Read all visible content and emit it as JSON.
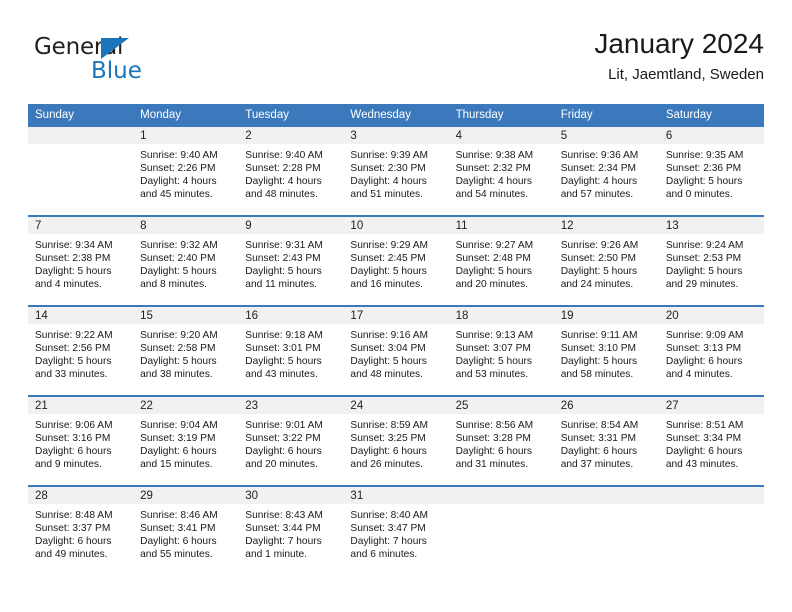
{
  "brand": {
    "name_top": "General",
    "name_bottom": "Blue",
    "accent_color": "#1b75bb"
  },
  "header": {
    "title": "January 2024",
    "subtitle": "Lit, Jaemtland, Sweden"
  },
  "theme": {
    "header_bg": "#3b79bc",
    "daynum_bg": "#f1f1f1",
    "text": "#1a1a1a"
  },
  "weekdays": [
    "Sunday",
    "Monday",
    "Tuesday",
    "Wednesday",
    "Thursday",
    "Friday",
    "Saturday"
  ],
  "weeks": [
    [
      {
        "day": "",
        "sunrise": "",
        "sunset": "",
        "daylight1": "",
        "daylight2": ""
      },
      {
        "day": "1",
        "sunrise": "Sunrise: 9:40 AM",
        "sunset": "Sunset: 2:26 PM",
        "daylight1": "Daylight: 4 hours",
        "daylight2": "and 45 minutes."
      },
      {
        "day": "2",
        "sunrise": "Sunrise: 9:40 AM",
        "sunset": "Sunset: 2:28 PM",
        "daylight1": "Daylight: 4 hours",
        "daylight2": "and 48 minutes."
      },
      {
        "day": "3",
        "sunrise": "Sunrise: 9:39 AM",
        "sunset": "Sunset: 2:30 PM",
        "daylight1": "Daylight: 4 hours",
        "daylight2": "and 51 minutes."
      },
      {
        "day": "4",
        "sunrise": "Sunrise: 9:38 AM",
        "sunset": "Sunset: 2:32 PM",
        "daylight1": "Daylight: 4 hours",
        "daylight2": "and 54 minutes."
      },
      {
        "day": "5",
        "sunrise": "Sunrise: 9:36 AM",
        "sunset": "Sunset: 2:34 PM",
        "daylight1": "Daylight: 4 hours",
        "daylight2": "and 57 minutes."
      },
      {
        "day": "6",
        "sunrise": "Sunrise: 9:35 AM",
        "sunset": "Sunset: 2:36 PM",
        "daylight1": "Daylight: 5 hours",
        "daylight2": "and 0 minutes."
      }
    ],
    [
      {
        "day": "7",
        "sunrise": "Sunrise: 9:34 AM",
        "sunset": "Sunset: 2:38 PM",
        "daylight1": "Daylight: 5 hours",
        "daylight2": "and 4 minutes."
      },
      {
        "day": "8",
        "sunrise": "Sunrise: 9:32 AM",
        "sunset": "Sunset: 2:40 PM",
        "daylight1": "Daylight: 5 hours",
        "daylight2": "and 8 minutes."
      },
      {
        "day": "9",
        "sunrise": "Sunrise: 9:31 AM",
        "sunset": "Sunset: 2:43 PM",
        "daylight1": "Daylight: 5 hours",
        "daylight2": "and 11 minutes."
      },
      {
        "day": "10",
        "sunrise": "Sunrise: 9:29 AM",
        "sunset": "Sunset: 2:45 PM",
        "daylight1": "Daylight: 5 hours",
        "daylight2": "and 16 minutes."
      },
      {
        "day": "11",
        "sunrise": "Sunrise: 9:27 AM",
        "sunset": "Sunset: 2:48 PM",
        "daylight1": "Daylight: 5 hours",
        "daylight2": "and 20 minutes."
      },
      {
        "day": "12",
        "sunrise": "Sunrise: 9:26 AM",
        "sunset": "Sunset: 2:50 PM",
        "daylight1": "Daylight: 5 hours",
        "daylight2": "and 24 minutes."
      },
      {
        "day": "13",
        "sunrise": "Sunrise: 9:24 AM",
        "sunset": "Sunset: 2:53 PM",
        "daylight1": "Daylight: 5 hours",
        "daylight2": "and 29 minutes."
      }
    ],
    [
      {
        "day": "14",
        "sunrise": "Sunrise: 9:22 AM",
        "sunset": "Sunset: 2:56 PM",
        "daylight1": "Daylight: 5 hours",
        "daylight2": "and 33 minutes."
      },
      {
        "day": "15",
        "sunrise": "Sunrise: 9:20 AM",
        "sunset": "Sunset: 2:58 PM",
        "daylight1": "Daylight: 5 hours",
        "daylight2": "and 38 minutes."
      },
      {
        "day": "16",
        "sunrise": "Sunrise: 9:18 AM",
        "sunset": "Sunset: 3:01 PM",
        "daylight1": "Daylight: 5 hours",
        "daylight2": "and 43 minutes."
      },
      {
        "day": "17",
        "sunrise": "Sunrise: 9:16 AM",
        "sunset": "Sunset: 3:04 PM",
        "daylight1": "Daylight: 5 hours",
        "daylight2": "and 48 minutes."
      },
      {
        "day": "18",
        "sunrise": "Sunrise: 9:13 AM",
        "sunset": "Sunset: 3:07 PM",
        "daylight1": "Daylight: 5 hours",
        "daylight2": "and 53 minutes."
      },
      {
        "day": "19",
        "sunrise": "Sunrise: 9:11 AM",
        "sunset": "Sunset: 3:10 PM",
        "daylight1": "Daylight: 5 hours",
        "daylight2": "and 58 minutes."
      },
      {
        "day": "20",
        "sunrise": "Sunrise: 9:09 AM",
        "sunset": "Sunset: 3:13 PM",
        "daylight1": "Daylight: 6 hours",
        "daylight2": "and 4 minutes."
      }
    ],
    [
      {
        "day": "21",
        "sunrise": "Sunrise: 9:06 AM",
        "sunset": "Sunset: 3:16 PM",
        "daylight1": "Daylight: 6 hours",
        "daylight2": "and 9 minutes."
      },
      {
        "day": "22",
        "sunrise": "Sunrise: 9:04 AM",
        "sunset": "Sunset: 3:19 PM",
        "daylight1": "Daylight: 6 hours",
        "daylight2": "and 15 minutes."
      },
      {
        "day": "23",
        "sunrise": "Sunrise: 9:01 AM",
        "sunset": "Sunset: 3:22 PM",
        "daylight1": "Daylight: 6 hours",
        "daylight2": "and 20 minutes."
      },
      {
        "day": "24",
        "sunrise": "Sunrise: 8:59 AM",
        "sunset": "Sunset: 3:25 PM",
        "daylight1": "Daylight: 6 hours",
        "daylight2": "and 26 minutes."
      },
      {
        "day": "25",
        "sunrise": "Sunrise: 8:56 AM",
        "sunset": "Sunset: 3:28 PM",
        "daylight1": "Daylight: 6 hours",
        "daylight2": "and 31 minutes."
      },
      {
        "day": "26",
        "sunrise": "Sunrise: 8:54 AM",
        "sunset": "Sunset: 3:31 PM",
        "daylight1": "Daylight: 6 hours",
        "daylight2": "and 37 minutes."
      },
      {
        "day": "27",
        "sunrise": "Sunrise: 8:51 AM",
        "sunset": "Sunset: 3:34 PM",
        "daylight1": "Daylight: 6 hours",
        "daylight2": "and 43 minutes."
      }
    ],
    [
      {
        "day": "28",
        "sunrise": "Sunrise: 8:48 AM",
        "sunset": "Sunset: 3:37 PM",
        "daylight1": "Daylight: 6 hours",
        "daylight2": "and 49 minutes."
      },
      {
        "day": "29",
        "sunrise": "Sunrise: 8:46 AM",
        "sunset": "Sunset: 3:41 PM",
        "daylight1": "Daylight: 6 hours",
        "daylight2": "and 55 minutes."
      },
      {
        "day": "30",
        "sunrise": "Sunrise: 8:43 AM",
        "sunset": "Sunset: 3:44 PM",
        "daylight1": "Daylight: 7 hours",
        "daylight2": "and 1 minute."
      },
      {
        "day": "31",
        "sunrise": "Sunrise: 8:40 AM",
        "sunset": "Sunset: 3:47 PM",
        "daylight1": "Daylight: 7 hours",
        "daylight2": "and 6 minutes."
      },
      {
        "day": "",
        "sunrise": "",
        "sunset": "",
        "daylight1": "",
        "daylight2": ""
      },
      {
        "day": "",
        "sunrise": "",
        "sunset": "",
        "daylight1": "",
        "daylight2": ""
      },
      {
        "day": "",
        "sunrise": "",
        "sunset": "",
        "daylight1": "",
        "daylight2": ""
      }
    ]
  ]
}
